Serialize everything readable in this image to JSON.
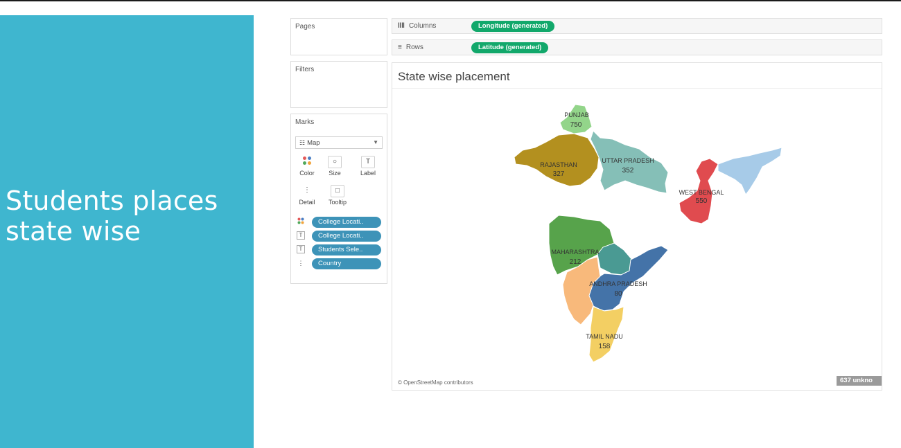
{
  "slide": {
    "title": "Students places state wise"
  },
  "tableau": {
    "pages_label": "Pages",
    "filters_label": "Filters",
    "marks": {
      "label": "Marks",
      "type_selected": "Map",
      "buttons": {
        "color": "Color",
        "size": "Size",
        "label": "Label",
        "detail": "Detail",
        "tooltip": "Tooltip"
      },
      "fields": [
        {
          "icon": "color-icon",
          "text": "College Locati.."
        },
        {
          "icon": "label-icon",
          "text": "College Locati.."
        },
        {
          "icon": "label-icon",
          "text": "Students Sele.."
        },
        {
          "icon": "detail-icon",
          "text": "Country"
        }
      ]
    },
    "columns": {
      "label": "Columns",
      "pill": "Longitude (generated)"
    },
    "rows": {
      "label": "Rows",
      "pill": "Latitude (generated)"
    },
    "viz": {
      "title": "State wise placement",
      "attribution": "© OpenStreetMap contributors",
      "unknown_badge": "637 unkno"
    },
    "map_states": [
      {
        "name": "PUNJAB",
        "value": "750",
        "color": "#93d58a"
      },
      {
        "name": "RAJASTHAN",
        "value": "327",
        "color": "#b3901f"
      },
      {
        "name": "UTTAR PRADESH",
        "value": "352",
        "color": "#85bfb7"
      },
      {
        "name": "WEST BENGAL",
        "value": "550",
        "color": "#e04b4f"
      },
      {
        "name": "MAHARASHTRA",
        "value": "212",
        "color": "#57a34b"
      },
      {
        "name": "ANDHRA PRADESH",
        "value": "80",
        "color": "#4473a8"
      },
      {
        "name": "TAMIL NADU",
        "value": "158",
        "color": "#f3cf63"
      }
    ],
    "colors": {
      "teal_panel": "#3fb6cf",
      "green_pill": "#12a86b",
      "blue_pill": "#3d93b8",
      "assam_region": "#a7cbe8",
      "karnataka_region": "#f8b97b",
      "telangana_region": "#4a9a93"
    }
  }
}
